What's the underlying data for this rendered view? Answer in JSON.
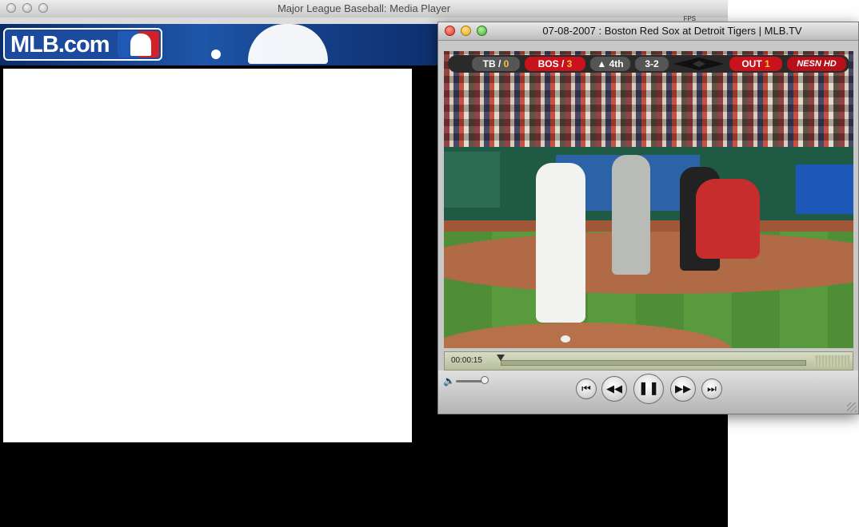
{
  "back_window": {
    "title": "Major League Baseball: Media Player",
    "logo_text": "MLB.com",
    "fps_label": "FPS"
  },
  "player": {
    "title": "07-08-2007 : Boston Red Sox at Detroit Tigers | MLB.TV",
    "scorebug": {
      "away_team": "TB",
      "away_score": "0",
      "home_team": "BOS",
      "home_score": "3",
      "inning": "▲ 4th",
      "count": "3-2",
      "outs_label": "OUT",
      "outs": "1",
      "network": "NESN HD"
    },
    "time": "00:00:15",
    "playback_progress": 0.0,
    "volume_level": 0.9,
    "icons": {
      "volume": "speaker-icon",
      "start": "skip-to-start-icon",
      "rewind": "rewind-icon",
      "pause": "pause-icon",
      "forward": "fast-forward-icon",
      "end": "skip-to-end-icon"
    }
  }
}
